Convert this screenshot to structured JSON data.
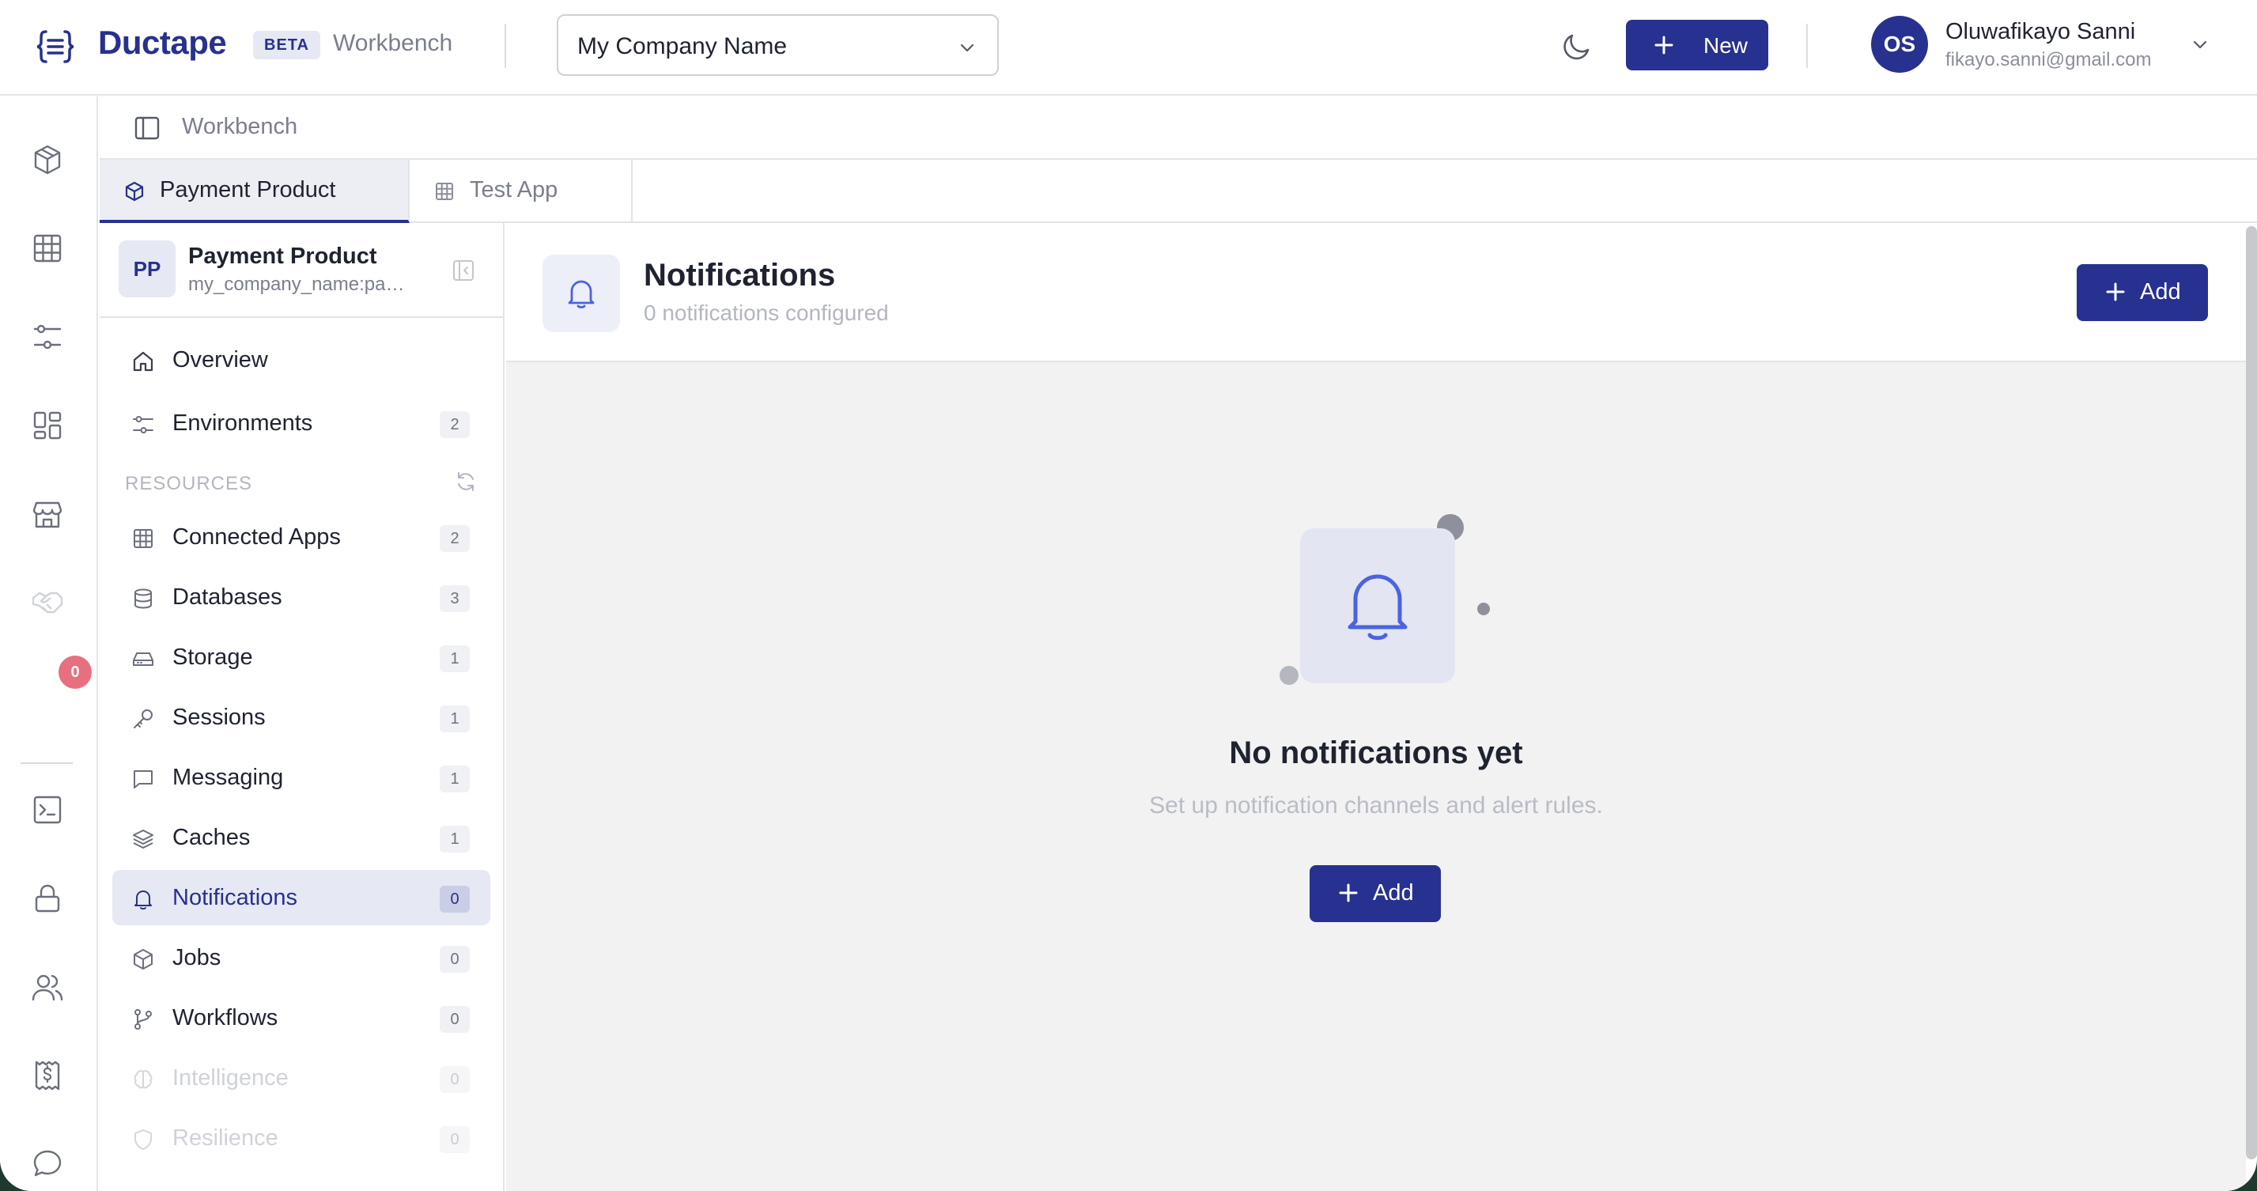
{
  "header": {
    "brand": "Ductape",
    "beta_badge": "BETA",
    "section_title": "Workbench",
    "company_select": "My Company Name",
    "new_button": "New",
    "user": {
      "initials": "OS",
      "name": "Oluwafikayo Sanni",
      "email": "fikayo.sanni@gmail.com"
    }
  },
  "rail": {
    "badge_count": "0",
    "icons": [
      "product-icon",
      "apps-grid-icon",
      "environments-icon",
      "dashboard-icon",
      "store-icon",
      "handshake-icon",
      "terminal-icon",
      "lock-icon",
      "users-icon",
      "billing-icon",
      "chat-icon"
    ]
  },
  "breadcrumb": {
    "current": "Workbench"
  },
  "tabs": [
    {
      "label": "Payment Product",
      "icon": "cube-icon",
      "active": true
    },
    {
      "label": "Test App",
      "icon": "grid-icon",
      "active": false
    }
  ],
  "sidebar": {
    "project": {
      "initials": "PP",
      "name": "Payment Product",
      "slug": "my_company_name:payment_product"
    },
    "top_items": [
      {
        "label": "Overview",
        "icon": "home-icon"
      },
      {
        "label": "Environments",
        "icon": "sliders-icon",
        "count": "2"
      }
    ],
    "section_label": "RESOURCES",
    "resources": [
      {
        "label": "Connected Apps",
        "icon": "grid-icon",
        "count": "2"
      },
      {
        "label": "Databases",
        "icon": "database-icon",
        "count": "3"
      },
      {
        "label": "Storage",
        "icon": "drive-icon",
        "count": "1"
      },
      {
        "label": "Sessions",
        "icon": "key-icon",
        "count": "1"
      },
      {
        "label": "Messaging",
        "icon": "message-icon",
        "count": "1"
      },
      {
        "label": "Caches",
        "icon": "layers-icon",
        "count": "1"
      },
      {
        "label": "Notifications",
        "icon": "bell-icon",
        "count": "0",
        "active": true
      },
      {
        "label": "Jobs",
        "icon": "box-icon",
        "count": "0"
      },
      {
        "label": "Workflows",
        "icon": "branch-icon",
        "count": "0"
      },
      {
        "label": "Intelligence",
        "icon": "brain-icon",
        "count": "0",
        "disabled": true
      },
      {
        "label": "Resilience",
        "icon": "shield-icon",
        "count": "0",
        "disabled": true
      }
    ]
  },
  "main": {
    "title": "Notifications",
    "subtitle": "0 notifications configured",
    "add_button": "Add",
    "empty": {
      "title": "No notifications yet",
      "subtitle": "Set up notification channels and alert rules.",
      "add_button": "Add"
    }
  },
  "colors": {
    "brand": "#27318f",
    "active_bg": "#e6e8f3",
    "badge": "#e8707e",
    "accent_icon": "#4a63e0"
  }
}
